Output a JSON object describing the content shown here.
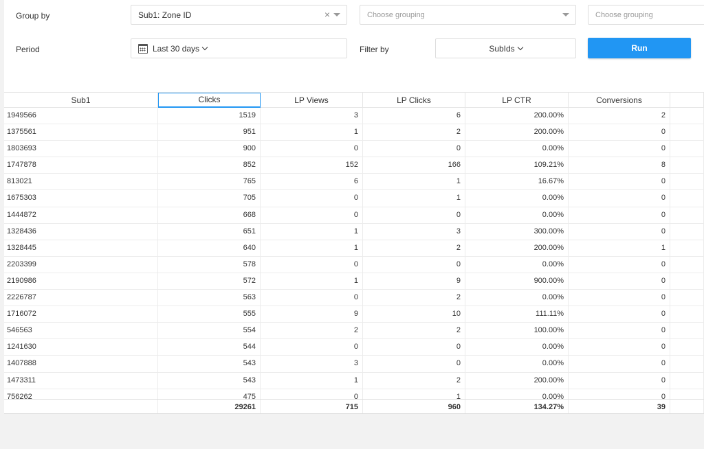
{
  "filters": {
    "group_by_label": "Group by",
    "group1_value": "Sub1: Zone ID",
    "group1_clear": "×",
    "group2_placeholder": "Choose grouping",
    "group3_placeholder": "Choose grouping",
    "period_label": "Period",
    "period_value": "Last 30 days",
    "filter_by_label": "Filter by",
    "filter_value": "SubIds",
    "run_label": "Run"
  },
  "table": {
    "columns": [
      "Sub1",
      "Clicks",
      "LP Views",
      "LP Clicks",
      "LP CTR",
      "Conversions"
    ],
    "active_column": 1,
    "rows": [
      [
        "1949566",
        "1519",
        "3",
        "6",
        "200.00%",
        "2"
      ],
      [
        "1375561",
        "951",
        "1",
        "2",
        "200.00%",
        "0"
      ],
      [
        "1803693",
        "900",
        "0",
        "0",
        "0.00%",
        "0"
      ],
      [
        "1747878",
        "852",
        "152",
        "166",
        "109.21%",
        "8"
      ],
      [
        "813021",
        "765",
        "6",
        "1",
        "16.67%",
        "0"
      ],
      [
        "1675303",
        "705",
        "0",
        "1",
        "0.00%",
        "0"
      ],
      [
        "1444872",
        "668",
        "0",
        "0",
        "0.00%",
        "0"
      ],
      [
        "1328436",
        "651",
        "1",
        "3",
        "300.00%",
        "0"
      ],
      [
        "1328445",
        "640",
        "1",
        "2",
        "200.00%",
        "1"
      ],
      [
        "2203399",
        "578",
        "0",
        "0",
        "0.00%",
        "0"
      ],
      [
        "2190986",
        "572",
        "1",
        "9",
        "900.00%",
        "0"
      ],
      [
        "2226787",
        "563",
        "0",
        "2",
        "0.00%",
        "0"
      ],
      [
        "1716072",
        "555",
        "9",
        "10",
        "111.11%",
        "0"
      ],
      [
        "546563",
        "554",
        "2",
        "2",
        "100.00%",
        "0"
      ],
      [
        "1241630",
        "544",
        "0",
        "0",
        "0.00%",
        "0"
      ],
      [
        "1407888",
        "543",
        "3",
        "0",
        "0.00%",
        "0"
      ],
      [
        "1473311",
        "543",
        "1",
        "2",
        "200.00%",
        "0"
      ],
      [
        "756262",
        "475",
        "0",
        "1",
        "0.00%",
        "0"
      ]
    ],
    "totals": [
      "",
      "29261",
      "715",
      "960",
      "134.27%",
      "39"
    ]
  }
}
